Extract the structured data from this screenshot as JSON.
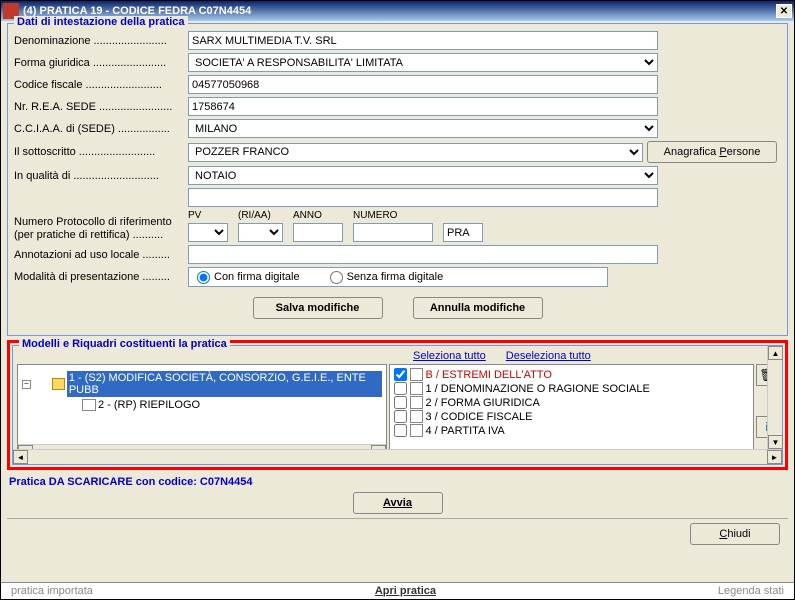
{
  "title": "(4) PRATICA 19 - CODICE FEDRA C07N4454",
  "header_section": "Dati di intestazione della pratica",
  "labels": {
    "denominazione": "Denominazione ........................",
    "forma": "Forma giuridica ........................",
    "codfisc": "Codice fiscale .........................",
    "rea": "Nr. R.E.A. SEDE ........................",
    "cciaa": "C.C.I.A.A. di (SEDE) .................",
    "sottoscritto": "Il sottoscritto .........................",
    "qualita": "In qualità di ............................",
    "protocollo": "Numero Protocollo di riferimento",
    "protocollo2": "(per pratiche di rettifica) ..........",
    "annotazioni": "Annotazioni ad uso locale .........",
    "modalita": "Modalità di presentazione .........",
    "pv": "PV",
    "riaa": "(RI/AA)",
    "anno": "ANNO",
    "numero": "NUMERO"
  },
  "values": {
    "denominazione": "SARX MULTIMEDIA T.V. SRL",
    "forma": "SOCIETA' A RESPONSABILITA' LIMITATA",
    "codfisc": "04577050968",
    "rea": "1758674",
    "cciaa": "MILANO",
    "sottoscritto": "POZZER FRANCO",
    "qualita": "NOTAIO",
    "pra": "PRA"
  },
  "radio": {
    "con": "Con firma digitale",
    "senza": "Senza firma digitale"
  },
  "buttons": {
    "anagrafica": "Anagrafica Persone",
    "salva": "Salva modifiche",
    "annulla": "Annulla modifiche",
    "avvia": "Avvia",
    "chiudi": "Chiudi",
    "apri": "Apri pratica"
  },
  "tree_section": "Modelli e Riquadri costituenti la pratica",
  "links": {
    "sel": "Seleziona tutto",
    "desel": "Deseleziona tutto"
  },
  "tree": {
    "item1": "1 - (S2) MODIFICA SOCIETÀ, CONSORZIO, G.E.I.E., ENTE PUBB",
    "item2": "2 - (RP) RIEPILOGO"
  },
  "checks": {
    "c1": "B / ESTREMI DELL'ATTO",
    "c2": "1 / DENOMINAZIONE O RAGIONE SOCIALE",
    "c3": "2 / FORMA GIURIDICA",
    "c4": "3 / CODICE FISCALE",
    "c5": "4 / PARTITA IVA"
  },
  "status": "Pratica DA SCARICARE con codice: C07N4454",
  "footer": {
    "left": "pratica importata",
    "right": "Legenda stati"
  }
}
